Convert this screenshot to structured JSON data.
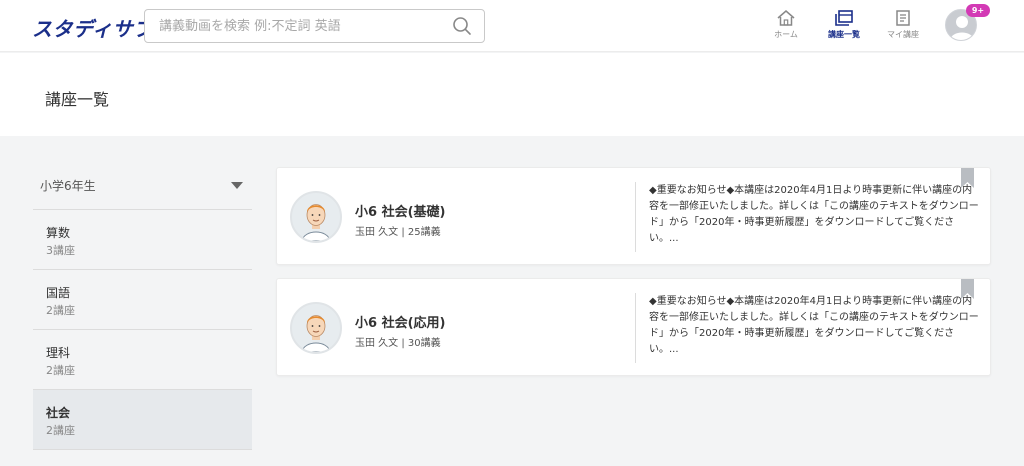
{
  "header": {
    "logo": "スタディサプリ",
    "search": {
      "placeholder": "講義動画を検索 例:不定詞 英語",
      "value": ""
    },
    "nav": [
      {
        "label": "ホーム",
        "icon": "home-icon",
        "active": false
      },
      {
        "label": "講座一覧",
        "icon": "course-list-icon",
        "active": true
      },
      {
        "label": "マイ講座",
        "icon": "my-course-icon",
        "active": false
      }
    ],
    "notification_badge": "9+"
  },
  "page": {
    "title": "講座一覧"
  },
  "sidebar": {
    "grade": "小学6年生",
    "subjects": [
      {
        "name": "算数",
        "count": "3講座",
        "selected": false
      },
      {
        "name": "国語",
        "count": "2講座",
        "selected": false
      },
      {
        "name": "理科",
        "count": "2講座",
        "selected": false
      },
      {
        "name": "社会",
        "count": "2講座",
        "selected": true
      }
    ]
  },
  "courses": [
    {
      "title": "小6 社会(基礎)",
      "meta": "玉田 久文 | 25講義",
      "notice": "◆重要なお知らせ◆本講座は2020年4月1日より時事更新に伴い講座の内容を一部修正いたしました。詳しくは「この講座のテキストをダウンロード」から「2020年・時事更新履歴」をダウンロードしてご覧ください。..."
    },
    {
      "title": "小6 社会(応用)",
      "meta": "玉田 久文 | 30講義",
      "notice": "◆重要なお知らせ◆本講座は2020年4月1日より時事更新に伴い講座の内容を一部修正いたしました。詳しくは「この講座のテキストをダウンロード」から「2020年・時事更新履歴」をダウンロードしてご覧ください。..."
    }
  ],
  "colors": {
    "brand": "#1b2f8a",
    "badge": "#d33ab5",
    "selected_bg": "#e6e9ec"
  }
}
